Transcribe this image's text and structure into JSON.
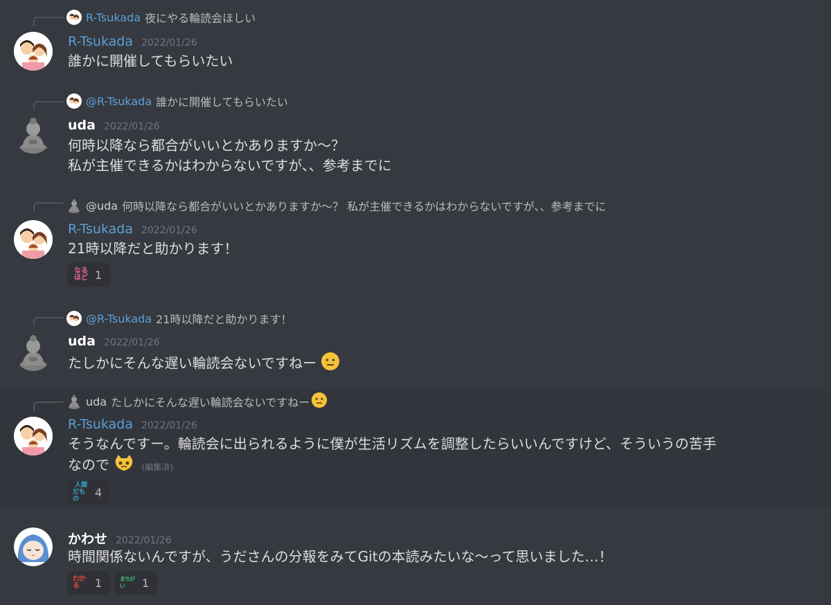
{
  "messages": [
    {
      "reply": {
        "name": "R-Tsukada",
        "text": "夜にやる輪読会ほしい"
      },
      "author": "R-Tsukada",
      "timestamp": "2022/01/26",
      "lines": [
        "誰かに開催してもらいたい"
      ]
    },
    {
      "reply": {
        "name": "@R-Tsukada",
        "text": "誰かに開催してもらいたい"
      },
      "author": "uda",
      "timestamp": "2022/01/26",
      "lines": [
        "何時以降なら都合がいいとかありますか〜？",
        "私が主催できるかはわからないですが、、参考までに"
      ]
    },
    {
      "reply": {
        "name": "@uda",
        "text": "何時以降なら都合がいいとかありますか〜？ 私が主催できるかはわからないですが、、参考までに"
      },
      "author": "R-Tsukada",
      "timestamp": "2022/01/26",
      "lines": [
        "21時以降だと助かります！"
      ],
      "reactions": [
        {
          "label_top": "なる",
          "label_bottom": "ほど",
          "count": "1"
        }
      ]
    },
    {
      "reply": {
        "name": "@R-Tsukada",
        "text": "21時以降だと助かります！"
      },
      "author": "uda",
      "timestamp": "2022/01/26",
      "lines": [
        "たしかにそんな遅い輪読会ないですねー"
      ]
    },
    {
      "reply": {
        "name": "uda",
        "text": "たしかにそんな遅い輪読会ないですねー"
      },
      "author": "R-Tsukada",
      "timestamp": "2022/01/26",
      "lines": [
        "そうなんですー。輪読会に出られるように僕が生活リズムを調整したらいいんですけど、そういうの苦手",
        "なので"
      ],
      "edited": "(編集済)",
      "reactions": [
        {
          "label_top": "人間",
          "label_bottom": "だもの",
          "count": "4"
        }
      ]
    },
    {
      "author": "かわせ",
      "timestamp": "2022/01/26",
      "lines": [
        "時間関係ないんですが、うださんの分報をみてGitの本読みたいな〜って思いました…！"
      ],
      "reactions": [
        {
          "label_top": "わかる",
          "label_bottom": "",
          "count": "1"
        },
        {
          "label_top": "まちがい",
          "label_bottom": "",
          "count": "1"
        }
      ]
    }
  ],
  "colors": {
    "background": "#36393f",
    "link_name": "#5ba0d8",
    "reaction_bg": "#2f3136"
  }
}
